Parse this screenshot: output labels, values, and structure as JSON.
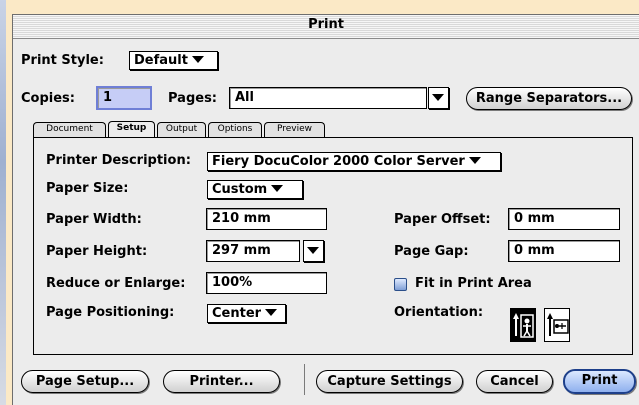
{
  "window": {
    "title": "Print"
  },
  "print_style": {
    "label": "Print Style:",
    "value": "Default"
  },
  "copies": {
    "label": "Copies:",
    "value": "1"
  },
  "pages": {
    "label": "Pages:",
    "value": "All"
  },
  "range_separators_label": "Range Separators...",
  "tabs": [
    {
      "label": "Document",
      "active": false
    },
    {
      "label": "Setup",
      "active": true
    },
    {
      "label": "Output",
      "active": false
    },
    {
      "label": "Options",
      "active": false
    },
    {
      "label": "Preview",
      "active": false
    }
  ],
  "setup": {
    "printer_description": {
      "label": "Printer Description:",
      "value": "Fiery DocuColor 2000 Color Server"
    },
    "paper_size": {
      "label": "Paper Size:",
      "value": "Custom"
    },
    "paper_width": {
      "label": "Paper Width:",
      "value": "210 mm"
    },
    "paper_height": {
      "label": "Paper Height:",
      "value": "297 mm"
    },
    "reduce_enlarge": {
      "label": "Reduce or Enlarge:",
      "value": "100%"
    },
    "page_positioning": {
      "label": "Page Positioning:",
      "value": "Center"
    },
    "paper_offset": {
      "label": "Paper Offset:",
      "value": "0 mm"
    },
    "page_gap": {
      "label": "Page Gap:",
      "value": "0 mm"
    },
    "fit_in_print_area": {
      "label": "Fit in Print Area",
      "checked": true
    },
    "orientation": {
      "label": "Orientation:",
      "selected": "portrait"
    }
  },
  "buttons": {
    "page_setup": "Page Setup...",
    "printer": "Printer...",
    "capture_settings": "Capture Settings",
    "cancel": "Cancel",
    "print": "Print"
  },
  "colors": {
    "window_bg": "#ececec",
    "desktop_bg": "#fbe9c6",
    "default_button": "#8fb0ee"
  }
}
